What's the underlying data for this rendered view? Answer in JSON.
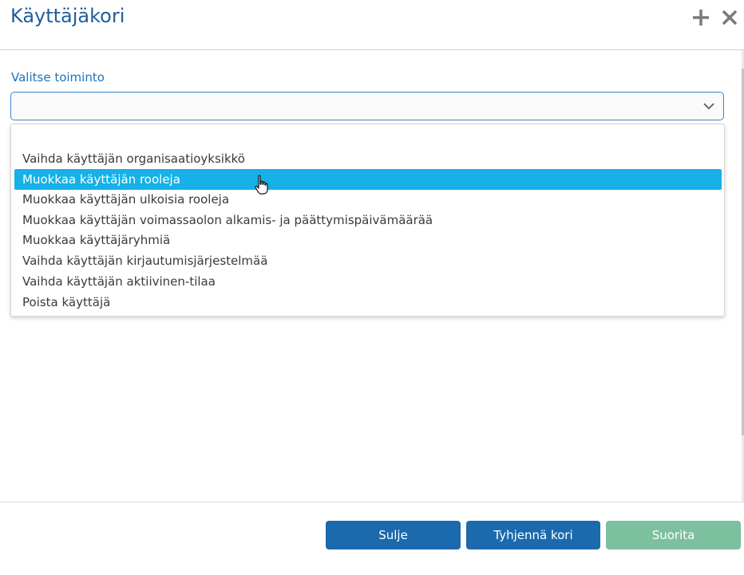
{
  "dialog": {
    "title": "Käyttäjäkori",
    "add_icon": "plus-icon",
    "close_icon": "close-icon"
  },
  "form": {
    "label": "Valitse toiminto",
    "select_value": "",
    "select_icon": "chevron-down-icon"
  },
  "options": [
    {
      "label": ""
    },
    {
      "label": "Vaihda käyttäjän organisaatioyksikkö"
    },
    {
      "label": "Muokkaa käyttäjän rooleja"
    },
    {
      "label": "Muokkaa käyttäjän ulkoisia rooleja"
    },
    {
      "label": "Muokkaa käyttäjän voimassaolon alkamis- ja päättymispäivämäärää"
    },
    {
      "label": "Muokkaa käyttäjäryhmiä"
    },
    {
      "label": "Vaihda käyttäjän kirjautumisjärjestelmää"
    },
    {
      "label": "Vaihda käyttäjän aktiivinen-tilaa"
    },
    {
      "label": "Poista käyttäjä"
    }
  ],
  "highlighted_option": "Muokkaa käyttäjän rooleja",
  "footer": {
    "close_label": "Sulje",
    "empty_label": "Tyhjennä kori",
    "run_label": "Suorita"
  },
  "colors": {
    "title": "#1f5e9e",
    "highlight": "#15b1e8",
    "primary_button": "#1b6aad",
    "disabled_button": "#7cc0a0"
  }
}
